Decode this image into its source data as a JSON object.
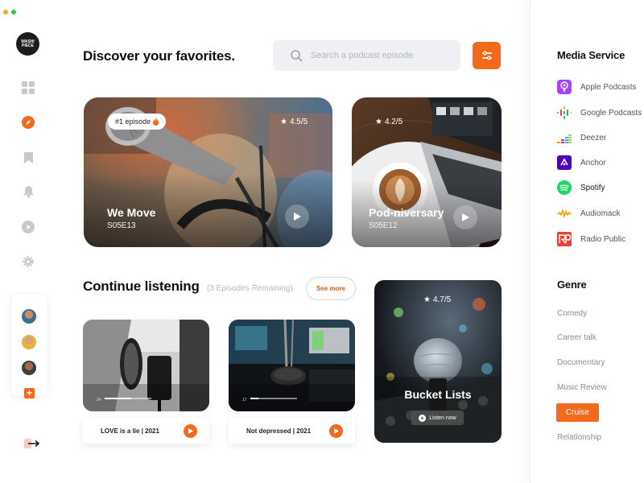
{
  "header": {
    "title": "Discover your favorites.",
    "search_placeholder": "Search a podcast episode"
  },
  "logo": {
    "text": "WASHI PIECE"
  },
  "nav": {
    "items": [
      "grid-icon",
      "compass-icon",
      "bookmark-icon",
      "bell-icon",
      "play-circle-icon",
      "gear-icon"
    ],
    "active": "compass-icon"
  },
  "featured": [
    {
      "badge": "#1 episode",
      "rating": "4.5/5",
      "title": "We Move",
      "episode": "S05E13"
    },
    {
      "rating": "4.2/5",
      "title": "Pod-niversary",
      "episode": "S05E12"
    }
  ],
  "continue": {
    "title": "Continue listening",
    "note": "(3 Episodes Remaining)",
    "see_more": "See more",
    "episodes": [
      {
        "label": "LOVE is a lie | 2021",
        "time": "24",
        "progress": 0.57
      },
      {
        "label": "Not depressed | 2021",
        "time": "17",
        "progress": 0.18
      }
    ],
    "highlight": {
      "rating": "4.7/5",
      "title": "Bucket Lists",
      "button": "Listen now"
    }
  },
  "media_service": {
    "title": "Media Service",
    "items": [
      "Apple Podcasts",
      "Google Podcasts",
      "Deezer",
      "Anchor",
      "Spotify",
      "Audiomack",
      "Radio Public"
    ]
  },
  "genre": {
    "title": "Genre",
    "items": [
      "Comedy",
      "Career talk",
      "Documentary",
      "Music Review",
      "Cruise",
      "Relationship"
    ],
    "active": "Cruise"
  },
  "colors": {
    "accent": "#f26a1b",
    "dark": "#111111",
    "muted": "#8d8d8d"
  }
}
